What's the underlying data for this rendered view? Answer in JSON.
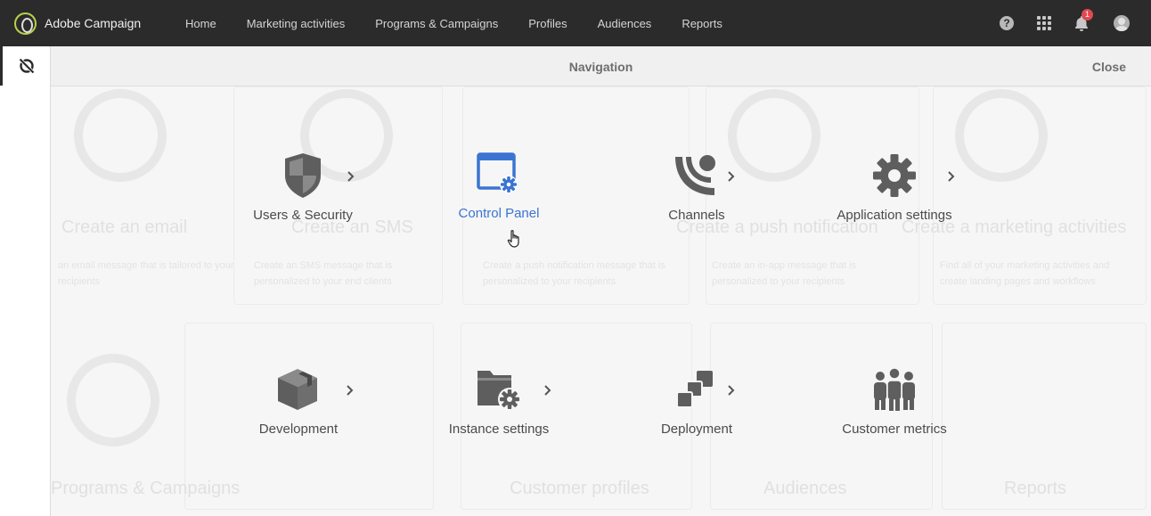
{
  "app": {
    "brand_name": "Adobe Campaign",
    "notification_count": "1",
    "accent_color": "#3b74d2",
    "topbar_color": "#2b2b2b"
  },
  "topnav": {
    "items": [
      {
        "label": "Home"
      },
      {
        "label": "Marketing activities"
      },
      {
        "label": "Programs & Campaigns"
      },
      {
        "label": "Profiles"
      },
      {
        "label": "Audiences"
      },
      {
        "label": "Reports"
      }
    ]
  },
  "navigation_panel": {
    "title": "Navigation",
    "close_label": "Close",
    "tiles": [
      {
        "label": "Users & Security",
        "icon": "shield-icon",
        "has_chevron": true
      },
      {
        "label": "Control Panel",
        "icon": "control-panel-icon",
        "has_chevron": false,
        "active": true
      },
      {
        "label": "Channels",
        "icon": "channels-icon",
        "has_chevron": true
      },
      {
        "label": "Application settings",
        "icon": "gear-icon",
        "has_chevron": true
      },
      {
        "label": "Development",
        "icon": "cube-icon",
        "has_chevron": true
      },
      {
        "label": "Instance settings",
        "icon": "folder-gear-icon",
        "has_chevron": true
      },
      {
        "label": "Deployment",
        "icon": "deployment-icon",
        "has_chevron": true
      },
      {
        "label": "Customer metrics",
        "icon": "people-icon",
        "has_chevron": false
      }
    ]
  },
  "background_cards": {
    "titles": [
      "Create an email",
      "Create an SMS",
      "Create a push notification",
      "Create a marketing activities",
      "Programs & Campaigns",
      "Customer profiles",
      "Audiences",
      "Reports"
    ],
    "descriptions": [
      "an email message that is tailored to your recipients",
      "Create an SMS message that is personalized to your end clients",
      "Create a push notification message that is personalized to your recipients",
      "Create an in-app message that is personalized to your recipients",
      "Find all of your marketing activities and create landing pages and workflows"
    ]
  }
}
